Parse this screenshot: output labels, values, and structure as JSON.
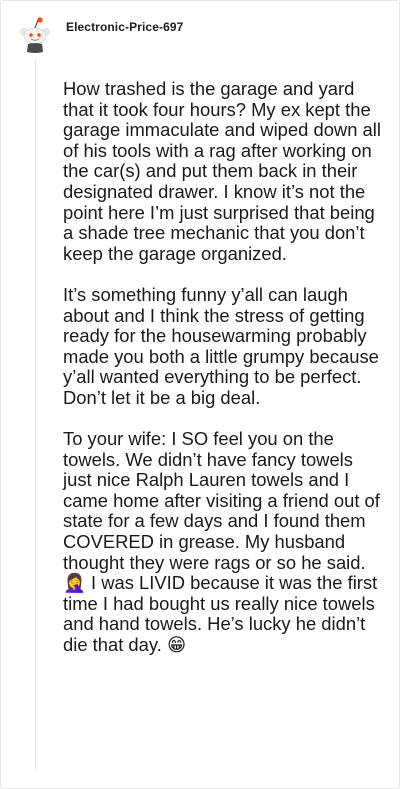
{
  "comment": {
    "author": "Electronic-Price-697",
    "avatar_icon": "reddit-snoo-avatar-icon",
    "paragraphs": [
      "How trashed is the garage and yard that it took four hours? My ex kept the garage immaculate and wiped down all of his tools with a rag after working on the car(s) and put them back in their designated drawer. I know it’s not the point here I’m just surprised that being a shade tree mechanic that you don’t keep the garage organized.",
      "It’s something funny y’all can laugh about and I think the stress of getting ready for the housewarming probably made you both a little grumpy because y’all wanted everything to be perfect. Don’t let it be a big deal.",
      "To your wife: I SO feel you on the towels. We didn’t have fancy towels just nice Ralph Lauren towels and I came home after visiting a friend out of state for a few days and I found them COVERED in grease. My husband thought they were rags or so he said. 🤦‍♀️ I was LIVID because it was the first time I had bought us really nice towels and hand towels. He’s lucky he didn’t die that day. 😁"
    ]
  },
  "colors": {
    "text": "#1c1c1c",
    "thread_line": "#e4e4e4",
    "snoo_orange": "#ff4500"
  }
}
